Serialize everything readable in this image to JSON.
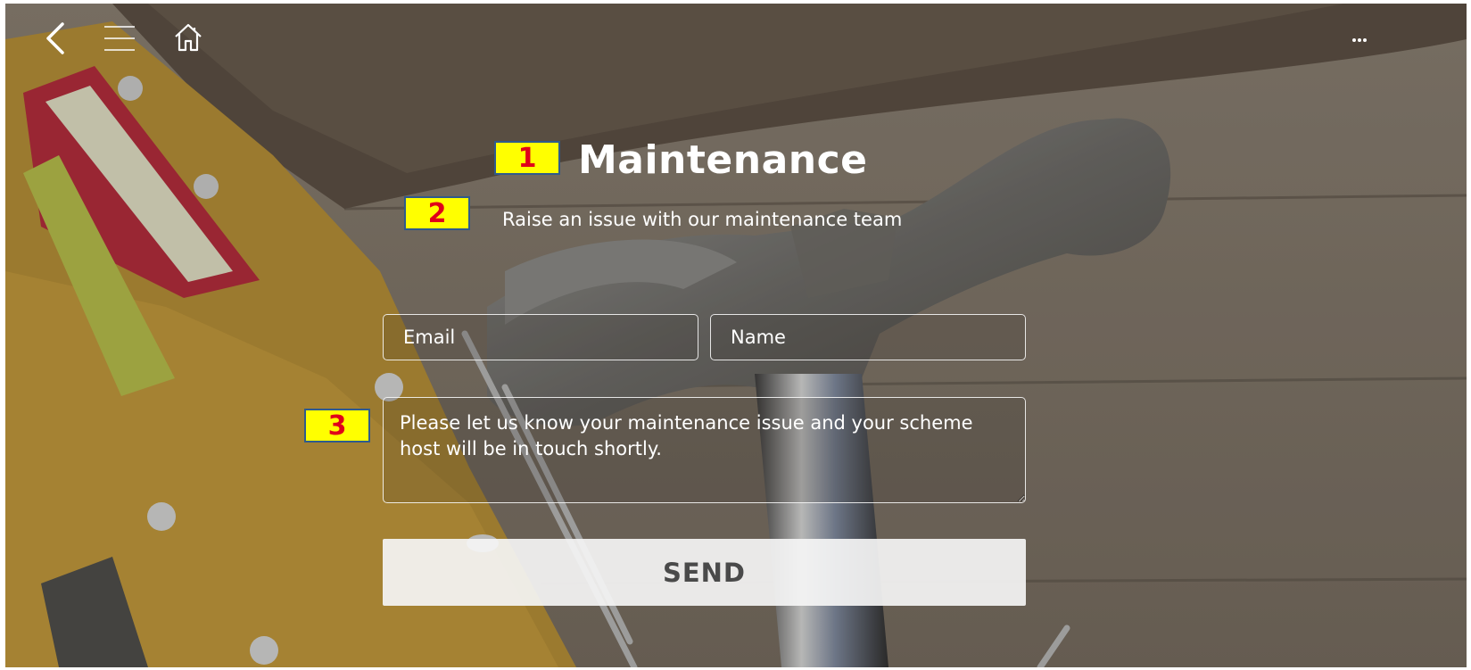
{
  "header": {
    "back_icon": "chevron-left-icon",
    "menu_icon": "hamburger-menu-icon",
    "home_icon": "home-icon",
    "more_label": "..."
  },
  "page": {
    "title": "Maintenance",
    "subtitle": "Raise an issue with our maintenance team"
  },
  "annotations": {
    "marker_1": "1",
    "marker_2": "2",
    "marker_3": "3",
    "color_fill": "#ffff00",
    "color_text": "#e0001a"
  },
  "form": {
    "email_placeholder": "Email",
    "name_placeholder": "Name",
    "message_placeholder": "Please let us know your maintenance issue and your scheme host will be in touch shortly.",
    "send_label": "SEND"
  }
}
